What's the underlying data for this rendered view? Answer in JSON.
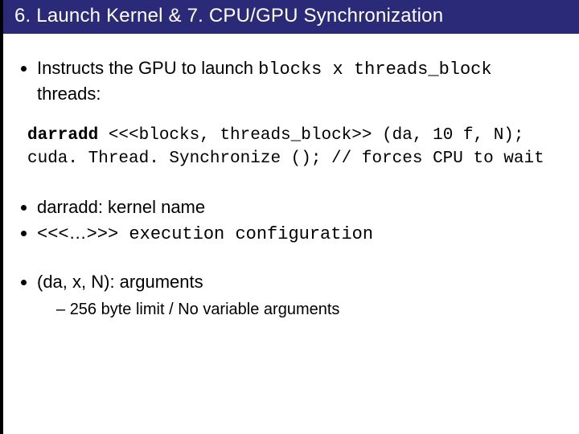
{
  "title": "6. Launch Kernel & 7. CPU/GPU Synchronization",
  "bullet1_pre": "Instructs the GPU to launch ",
  "bullet1_code": "blocks x threads_block",
  "bullet1_post": "threads:",
  "code": {
    "l1_kw": "darradd",
    "l1_rest": " <<<blocks, threads_block>> (da, 10 f, N);",
    "l2": "cuda. Thread. Synchronize (); // forces CPU to wait"
  },
  "bullet2": "darradd: kernel name",
  "bullet3_pre": "<<<",
  "bullet3_mid": "…",
  "bullet3_post": ">>> execution configuration",
  "bullet4": "(da, x, N): arguments",
  "sub1": "256 byte limit / No variable arguments"
}
